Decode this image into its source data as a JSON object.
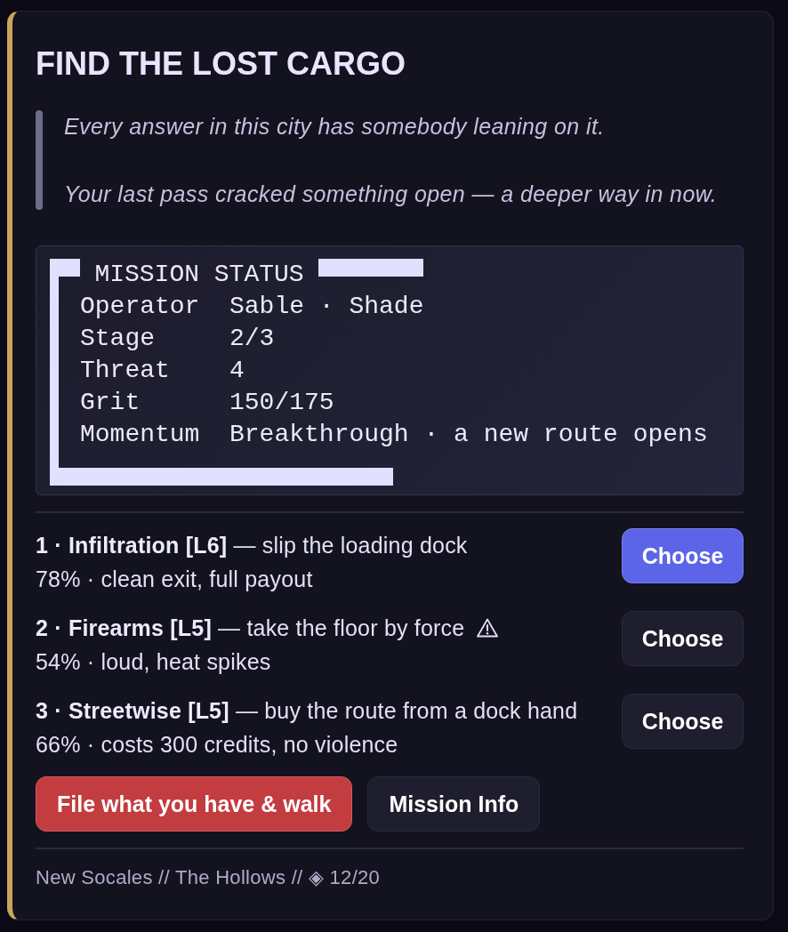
{
  "mission": {
    "title": "FIND THE LOST CARGO",
    "quote": [
      "Every answer in this city has somebody leaning on it.",
      "Your last pass cracked something open — a deeper way in now."
    ]
  },
  "status": {
    "title": "MISSION STATUS",
    "rows": [
      {
        "label": "Operator",
        "value": "Sable · Shade"
      },
      {
        "label": "Stage",
        "value": "2/3"
      },
      {
        "label": "Threat",
        "value": "4"
      },
      {
        "label": "Grit",
        "value": "150/175"
      },
      {
        "label": "Momentum",
        "value": "Breakthrough · a new route opens"
      }
    ]
  },
  "options": [
    {
      "text": "**1 · Infiltration [L6]** — slip the loading dock",
      "detail": "78% · clean exit, full payout",
      "warning": false,
      "selected": true,
      "button": "Choose"
    },
    {
      "text": "**2 · Firearms [L5]** — take the floor by force",
      "detail": "54% · loud, heat spikes",
      "warning": true,
      "selected": false,
      "button": "Choose"
    },
    {
      "text": "**3 · Streetwise [L5]** — buy the route from a dock hand",
      "detail": "66% · costs 300 credits, no violence",
      "warning": false,
      "selected": false,
      "button": "Choose"
    }
  ],
  "actions": [
    {
      "label": "File what you have & walk",
      "kind": "danger"
    },
    {
      "label": "Mission Info",
      "kind": "secondary"
    }
  ],
  "footer": "New Socales // The Hollows // ◈ 12/20"
}
